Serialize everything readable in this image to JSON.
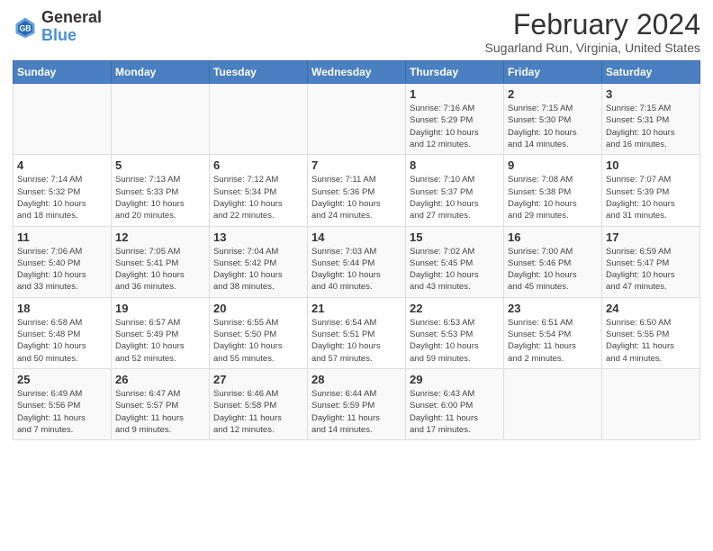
{
  "header": {
    "logo_line1": "General",
    "logo_line2": "Blue",
    "title": "February 2024",
    "subtitle": "Sugarland Run, Virginia, United States"
  },
  "weekdays": [
    "Sunday",
    "Monday",
    "Tuesday",
    "Wednesday",
    "Thursday",
    "Friday",
    "Saturday"
  ],
  "weeks": [
    [
      {
        "num": "",
        "info": ""
      },
      {
        "num": "",
        "info": ""
      },
      {
        "num": "",
        "info": ""
      },
      {
        "num": "",
        "info": ""
      },
      {
        "num": "1",
        "info": "Sunrise: 7:16 AM\nSunset: 5:29 PM\nDaylight: 10 hours\nand 12 minutes."
      },
      {
        "num": "2",
        "info": "Sunrise: 7:15 AM\nSunset: 5:30 PM\nDaylight: 10 hours\nand 14 minutes."
      },
      {
        "num": "3",
        "info": "Sunrise: 7:15 AM\nSunset: 5:31 PM\nDaylight: 10 hours\nand 16 minutes."
      }
    ],
    [
      {
        "num": "4",
        "info": "Sunrise: 7:14 AM\nSunset: 5:32 PM\nDaylight: 10 hours\nand 18 minutes."
      },
      {
        "num": "5",
        "info": "Sunrise: 7:13 AM\nSunset: 5:33 PM\nDaylight: 10 hours\nand 20 minutes."
      },
      {
        "num": "6",
        "info": "Sunrise: 7:12 AM\nSunset: 5:34 PM\nDaylight: 10 hours\nand 22 minutes."
      },
      {
        "num": "7",
        "info": "Sunrise: 7:11 AM\nSunset: 5:36 PM\nDaylight: 10 hours\nand 24 minutes."
      },
      {
        "num": "8",
        "info": "Sunrise: 7:10 AM\nSunset: 5:37 PM\nDaylight: 10 hours\nand 27 minutes."
      },
      {
        "num": "9",
        "info": "Sunrise: 7:08 AM\nSunset: 5:38 PM\nDaylight: 10 hours\nand 29 minutes."
      },
      {
        "num": "10",
        "info": "Sunrise: 7:07 AM\nSunset: 5:39 PM\nDaylight: 10 hours\nand 31 minutes."
      }
    ],
    [
      {
        "num": "11",
        "info": "Sunrise: 7:06 AM\nSunset: 5:40 PM\nDaylight: 10 hours\nand 33 minutes."
      },
      {
        "num": "12",
        "info": "Sunrise: 7:05 AM\nSunset: 5:41 PM\nDaylight: 10 hours\nand 36 minutes."
      },
      {
        "num": "13",
        "info": "Sunrise: 7:04 AM\nSunset: 5:42 PM\nDaylight: 10 hours\nand 38 minutes."
      },
      {
        "num": "14",
        "info": "Sunrise: 7:03 AM\nSunset: 5:44 PM\nDaylight: 10 hours\nand 40 minutes."
      },
      {
        "num": "15",
        "info": "Sunrise: 7:02 AM\nSunset: 5:45 PM\nDaylight: 10 hours\nand 43 minutes."
      },
      {
        "num": "16",
        "info": "Sunrise: 7:00 AM\nSunset: 5:46 PM\nDaylight: 10 hours\nand 45 minutes."
      },
      {
        "num": "17",
        "info": "Sunrise: 6:59 AM\nSunset: 5:47 PM\nDaylight: 10 hours\nand 47 minutes."
      }
    ],
    [
      {
        "num": "18",
        "info": "Sunrise: 6:58 AM\nSunset: 5:48 PM\nDaylight: 10 hours\nand 50 minutes."
      },
      {
        "num": "19",
        "info": "Sunrise: 6:57 AM\nSunset: 5:49 PM\nDaylight: 10 hours\nand 52 minutes."
      },
      {
        "num": "20",
        "info": "Sunrise: 6:55 AM\nSunset: 5:50 PM\nDaylight: 10 hours\nand 55 minutes."
      },
      {
        "num": "21",
        "info": "Sunrise: 6:54 AM\nSunset: 5:51 PM\nDaylight: 10 hours\nand 57 minutes."
      },
      {
        "num": "22",
        "info": "Sunrise: 6:53 AM\nSunset: 5:53 PM\nDaylight: 10 hours\nand 59 minutes."
      },
      {
        "num": "23",
        "info": "Sunrise: 6:51 AM\nSunset: 5:54 PM\nDaylight: 11 hours\nand 2 minutes."
      },
      {
        "num": "24",
        "info": "Sunrise: 6:50 AM\nSunset: 5:55 PM\nDaylight: 11 hours\nand 4 minutes."
      }
    ],
    [
      {
        "num": "25",
        "info": "Sunrise: 6:49 AM\nSunset: 5:56 PM\nDaylight: 11 hours\nand 7 minutes."
      },
      {
        "num": "26",
        "info": "Sunrise: 6:47 AM\nSunset: 5:57 PM\nDaylight: 11 hours\nand 9 minutes."
      },
      {
        "num": "27",
        "info": "Sunrise: 6:46 AM\nSunset: 5:58 PM\nDaylight: 11 hours\nand 12 minutes."
      },
      {
        "num": "28",
        "info": "Sunrise: 6:44 AM\nSunset: 5:59 PM\nDaylight: 11 hours\nand 14 minutes."
      },
      {
        "num": "29",
        "info": "Sunrise: 6:43 AM\nSunset: 6:00 PM\nDaylight: 11 hours\nand 17 minutes."
      },
      {
        "num": "",
        "info": ""
      },
      {
        "num": "",
        "info": ""
      }
    ]
  ]
}
